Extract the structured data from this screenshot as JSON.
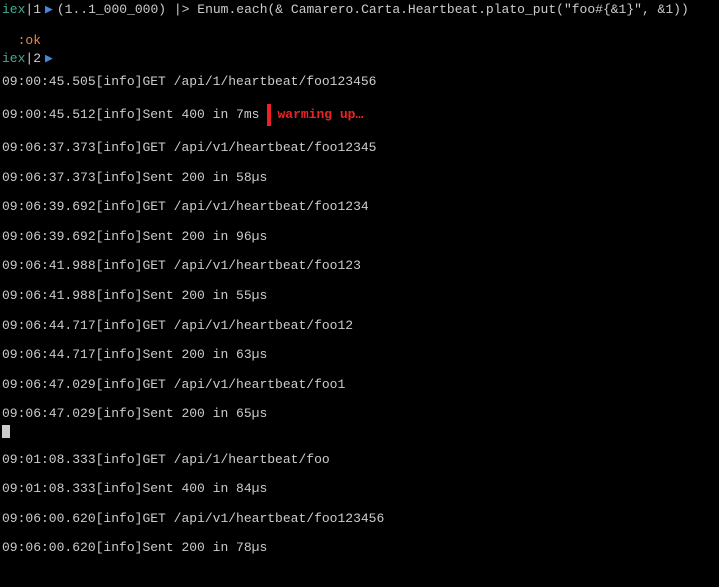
{
  "prompts": [
    {
      "label": "iex",
      "sep": "|",
      "num": "1",
      "arrow": "▶",
      "cmd": "(1..1_000_000) |> Enum.each(& Camarero.Carta.Heartbeat.plato_put(\"foo#{&1}\", &1))"
    },
    {
      "result": ":ok"
    },
    {
      "label": "iex",
      "sep": "|",
      "num": "2",
      "arrow": "▶",
      "cmd": ""
    }
  ],
  "annotation": "warming up…",
  "logs": [
    {
      "ts": "09:00:45.505",
      "level": "[info]",
      "msg": "GET /api/1/heartbeat/foo123456"
    },
    {
      "ts": "09:00:45.512",
      "level": "[info]",
      "msg": "Sent 400 in 7ms",
      "annotated": true
    },
    {
      "ts": "09:06:37.373",
      "level": "[info]",
      "msg": "GET /api/v1/heartbeat/foo12345"
    },
    {
      "ts": "09:06:37.373",
      "level": "[info]",
      "msg": "Sent 200 in 58µs"
    },
    {
      "ts": "09:06:39.692",
      "level": "[info]",
      "msg": "GET /api/v1/heartbeat/foo1234"
    },
    {
      "ts": "09:06:39.692",
      "level": "[info]",
      "msg": "Sent 200 in 96µs"
    },
    {
      "ts": "09:06:41.988",
      "level": "[info]",
      "msg": "GET /api/v1/heartbeat/foo123"
    },
    {
      "ts": "09:06:41.988",
      "level": "[info]",
      "msg": "Sent 200 in 55µs"
    },
    {
      "ts": "09:06:44.717",
      "level": "[info]",
      "msg": "GET /api/v1/heartbeat/foo12"
    },
    {
      "ts": "09:06:44.717",
      "level": "[info]",
      "msg": "Sent 200 in 63µs"
    },
    {
      "ts": "09:06:47.029",
      "level": "[info]",
      "msg": "GET /api/v1/heartbeat/foo1"
    },
    {
      "ts": "09:06:47.029",
      "level": "[info]",
      "msg": "Sent 200 in 65µs",
      "cursor": true
    },
    {
      "ts": "09:01:08.333",
      "level": "[info]",
      "msg": "GET /api/1/heartbeat/foo"
    },
    {
      "ts": "09:01:08.333",
      "level": "[info]",
      "msg": "Sent 400 in 84µs"
    },
    {
      "ts": "09:06:00.620",
      "level": "[info]",
      "msg": "GET /api/v1/heartbeat/foo123456"
    },
    {
      "ts": "09:06:00.620",
      "level": "[info]",
      "msg": "Sent 200 in 78µs"
    }
  ]
}
